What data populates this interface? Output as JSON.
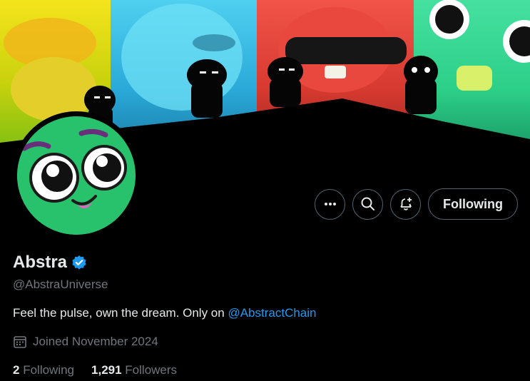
{
  "profile": {
    "name": "Abstra",
    "handle": "@AbstraUniverse",
    "verified": true,
    "bio_text": "Feel the pulse, own the dream. Only on ",
    "bio_mention": "@AbstractChain",
    "joined": "Joined November 2024",
    "following_count": "2",
    "following_label": "Following",
    "followers_count": "1,291",
    "followers_label": "Followers"
  },
  "actions": {
    "more_icon": "more-icon",
    "search_icon": "search-icon",
    "notify_icon": "bell-plus-icon",
    "follow_label": "Following"
  },
  "colors": {
    "accent": "#1d9bf0",
    "muted": "#71767b",
    "avatar_bg": "#28c26c"
  }
}
